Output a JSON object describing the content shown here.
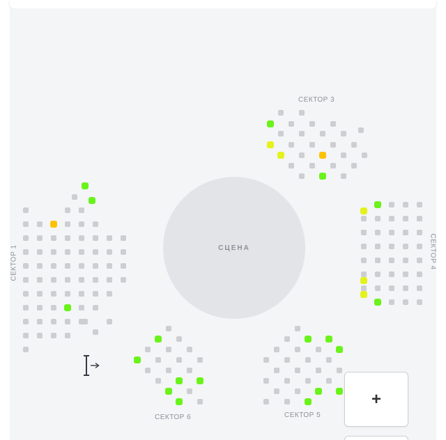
{
  "stage": {
    "label": "СЦЕНА"
  },
  "sectors": {
    "s1": "СЕКТОР 1",
    "s3": "СЕКТОР 3",
    "s4": "СЕКТОР 4",
    "s5": "СЕКТОР 5",
    "s6": "СЕКТОР 6"
  },
  "controls": {
    "zoom_in_label": "+"
  },
  "seat_status_colors": {
    "unavailable": "#cdced2",
    "available": "#6af31a",
    "available_alt": "#e4f21c",
    "highlighted": "#fcc200"
  },
  "icons": {
    "exit": "exit-arrow-icon"
  }
}
